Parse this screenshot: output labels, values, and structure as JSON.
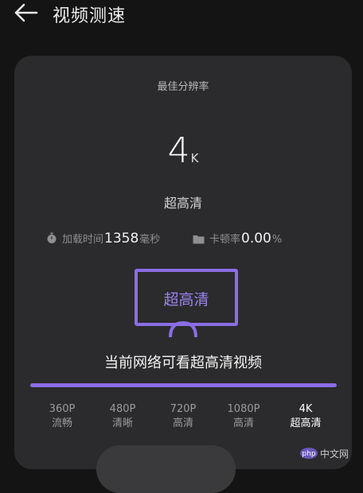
{
  "header": {
    "title": "视频测速"
  },
  "card": {
    "best_label": "最佳分辨率",
    "resolution_value": "4",
    "resolution_unit": "K",
    "quality_label": "超高清",
    "stats": {
      "load_label": "加载时间",
      "load_value": "1358",
      "load_unit": "毫秒",
      "stutter_label": "卡顿率",
      "stutter_value": "0.00",
      "stutter_unit": "%"
    },
    "monitor_label": "超高清",
    "network_message": "当前网络可看超高清视频",
    "progress_fraction": 1.0,
    "levels": [
      {
        "res": "360P",
        "name": "流畅"
      },
      {
        "res": "480P",
        "name": "清晰"
      },
      {
        "res": "720P",
        "name": "高清"
      },
      {
        "res": "1080P",
        "name": "高清"
      },
      {
        "res": "4K",
        "name": "超高清"
      }
    ],
    "active_level": "4K"
  },
  "watermark": {
    "text": "php 中文网"
  },
  "colors": {
    "accent": "#8b6de6",
    "background": "#141414",
    "card": "#2b2b2d"
  }
}
